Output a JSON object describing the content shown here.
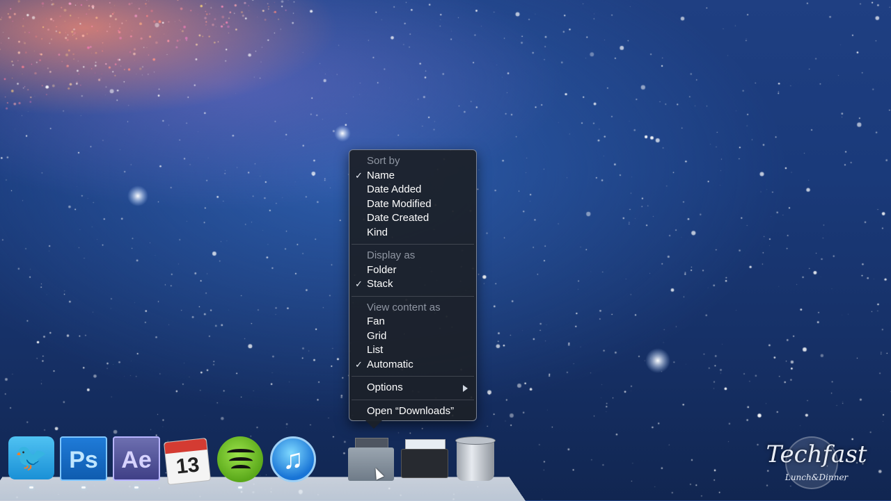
{
  "menu": {
    "sort_header": "Sort by",
    "sort_items": [
      {
        "label": "Name",
        "checked": true
      },
      {
        "label": "Date Added",
        "checked": false
      },
      {
        "label": "Date Modified",
        "checked": false
      },
      {
        "label": "Date Created",
        "checked": false
      },
      {
        "label": "Kind",
        "checked": false
      }
    ],
    "display_header": "Display as",
    "display_items": [
      {
        "label": "Folder",
        "checked": false
      },
      {
        "label": "Stack",
        "checked": true
      }
    ],
    "view_header": "View content as",
    "view_items": [
      {
        "label": "Fan",
        "checked": false
      },
      {
        "label": "Grid",
        "checked": false
      },
      {
        "label": "List",
        "checked": false
      },
      {
        "label": "Automatic",
        "checked": true
      }
    ],
    "options_label": "Options",
    "open_label": "Open “Downloads”",
    "check_glyph": "✓"
  },
  "dock": {
    "twitter_icon": "twitter-icon",
    "twitter_glyph": "🐦",
    "ps_label": "Ps",
    "ae_label": "Ae",
    "calendar_day": "13",
    "itunes_glyph": "♫"
  },
  "watermark": {
    "title": "Techfast",
    "subtitle": "Lunch&Dinner"
  },
  "colors": {
    "menu_bg": "#1c2028",
    "check": "#e8ecf2",
    "header_text": "#8f96a2"
  }
}
